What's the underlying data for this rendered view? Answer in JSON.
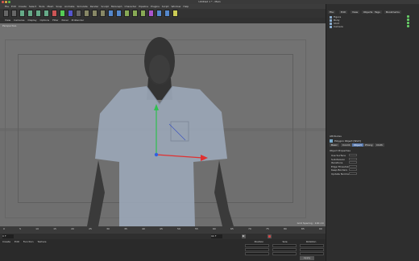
{
  "window": {
    "title": "Untitled 1 * - Main"
  },
  "menubar": {
    "items": [
      "File",
      "Edit",
      "Create",
      "Select",
      "Tools",
      "Mesh",
      "Snap",
      "Animate",
      "Simulate",
      "Render",
      "Sculpt",
      "MoGraph",
      "Character",
      "Pipeline",
      "Plugins",
      "Script",
      "Window",
      "Help"
    ]
  },
  "viewport_menu": {
    "items": [
      "View",
      "Cameras",
      "Display",
      "Options",
      "Filter",
      "Panel",
      "ProRender"
    ]
  },
  "viewport": {
    "label": "Perspective",
    "grid_info": "Grid Spacing : 100 cm"
  },
  "toolbar": {
    "icons": [
      "undo-icon",
      "redo-icon",
      "select-icon",
      "move-icon",
      "scale-icon",
      "rotate-icon",
      "axis-x-icon",
      "axis-y-icon",
      "axis-z-icon",
      "coord-icon",
      "render-view-icon",
      "render-icon",
      "render-settings-icon",
      "cube-icon",
      "pen-icon",
      "subdivision-icon",
      "array-icon",
      "instance-icon",
      "deformer-icon",
      "floor-icon",
      "camera-icon",
      "light-icon"
    ]
  },
  "timeline": {
    "ticks": [
      "0",
      "5",
      "10",
      "15",
      "20",
      "25",
      "30",
      "35",
      "40",
      "45",
      "50",
      "55",
      "60",
      "65",
      "70",
      "75",
      "80",
      "85",
      "90"
    ],
    "current_frame": "0 F",
    "end_frame": "90 F"
  },
  "bottom_panel": {
    "menu": [
      "Create",
      "Edit",
      "Function",
      "Texture"
    ],
    "coord_headers": [
      "Position",
      "Size",
      "Rotation"
    ],
    "apply_label": "Apply"
  },
  "object_manager": {
    "tabs": [
      "File",
      "Edit",
      "View",
      "Objects",
      "Tags",
      "Bookmarks"
    ],
    "objects": [
      "Figure",
      "Body",
      "Shirt",
      "Camera"
    ]
  },
  "attributes": {
    "header": "Attributes",
    "object_name": "Polygon Object [Shirt]",
    "tabs": [
      "Basic",
      "Coord.",
      "Object",
      "Phong",
      "Cloth"
    ],
    "section": "Object Properties",
    "props": [
      "Use Surface",
      "Subdivision",
      "Iterations",
      "Edge Threshold",
      "Keep Borders",
      "Update Normals"
    ]
  },
  "colors": {
    "accent": "#5a7bb0",
    "axis_x": "#e03030",
    "axis_y": "#30c050",
    "axis_z": "#3060e0"
  }
}
